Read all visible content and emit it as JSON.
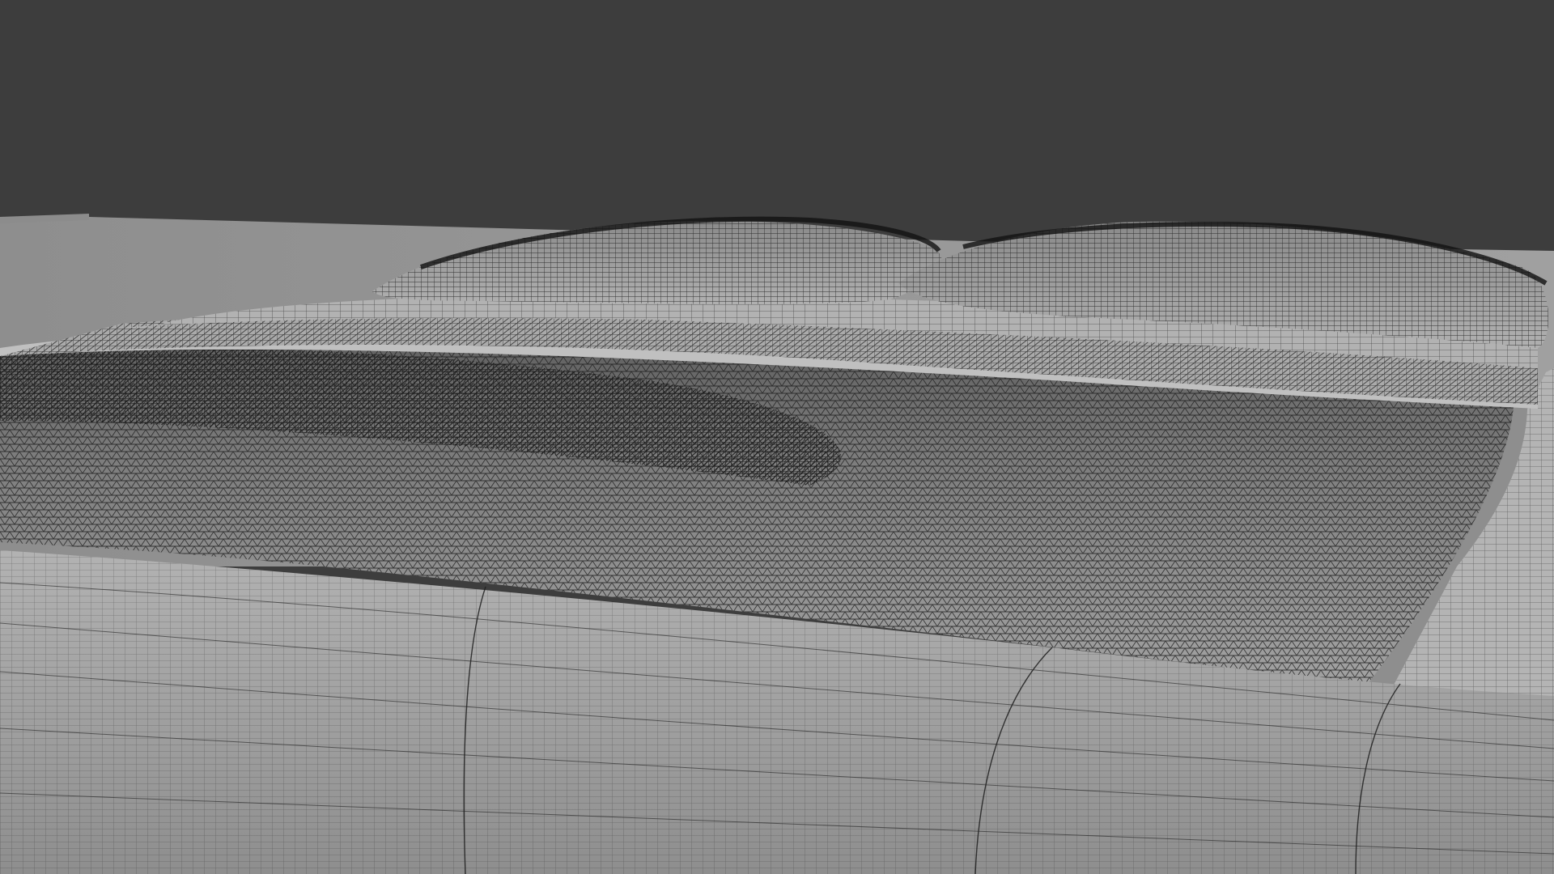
{
  "scene": {
    "subject": "wireframe-bed-render",
    "colors": {
      "background": "#3d3d3d",
      "wall": "#9a9a9a",
      "wall_top": "#8c8c8c",
      "frame": "#a8a8a8",
      "frame_shadow": "#8a8a8a",
      "frame_side": "#b4b4b4",
      "blanket": "#9e9e9e",
      "blanket_dark": "#6e6e6e",
      "sheet": "#b0b0b0",
      "pillow": "#a6a6a6",
      "pillow_dark": "#7a7a7a",
      "wire": "#1e1e1e"
    }
  }
}
